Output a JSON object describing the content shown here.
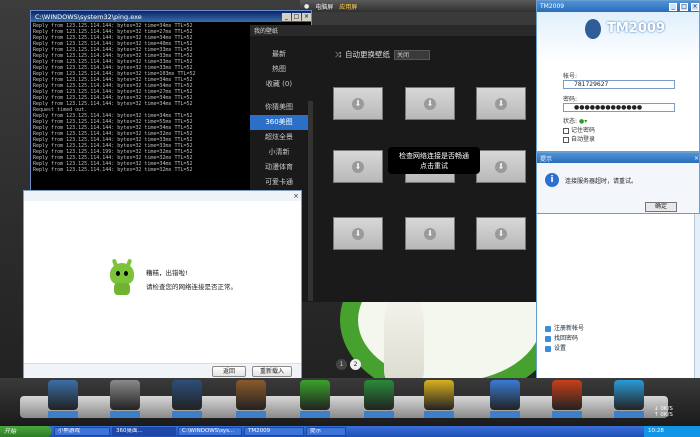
{
  "topbar": {
    "items": [
      "电脑屏",
      "应用屏"
    ],
    "active_index": 1
  },
  "cmd": {
    "title": "C:\\WINDOWS\\system32\\ping.exe",
    "lines": [
      "Reply from 123.125.114.144: bytes=32 time=34ms TTL=52",
      "Reply from 123.125.114.144: bytes=32 time=27ms TTL=52",
      "Reply from 123.125.114.144: bytes=32 time=34ms TTL=52",
      "Reply from 123.125.114.144: bytes=32 time=40ms TTL=52",
      "Reply from 123.125.114.144: bytes=32 time=33ms TTL=52",
      "Reply from 123.125.114.144: bytes=32 time=33ms TTL=52",
      "Reply from 123.125.114.144: bytes=32 time=33ms TTL=52",
      "Reply from 123.125.114.144: bytes=32 time=33ms TTL=52",
      "Reply from 123.125.114.144: bytes=32 time=103ms TTL=52",
      "Reply from 123.125.114.144: bytes=32 time=34ms TTL=52",
      "Reply from 123.125.114.144: bytes=32 time=34ms TTL=52",
      "Reply from 123.125.114.144: bytes=32 time=27ms TTL=52",
      "Reply from 123.125.114.144: bytes=32 time=34ms TTL=52",
      "Reply from 123.125.114.144: bytes=32 time=34ms TTL=52",
      "Request timed out.",
      "Reply from 123.125.114.144: bytes=32 time=34ms TTL=52",
      "Reply from 123.125.114.144: bytes=32 time=55ms TTL=52",
      "Reply from 123.125.114.144: bytes=32 time=34ms TTL=52",
      "Reply from 123.125.114.144: bytes=32 time=32ms TTL=52",
      "Reply from 123.125.114.144: bytes=32 time=33ms TTL=52",
      "Reply from 123.125.114.144: bytes=32 time=33ms TTL=52",
      "Reply from 123.125.114.199: bytes=32 time=32ms TTL=52",
      "Reply from 123.125.114.144: bytes=32 time=32ms TTL=52",
      "Reply from 123.125.114.144: bytes=32 time=34ms TTL=52",
      "Reply from 123.125.114.144: bytes=32 time=32ms TTL=52"
    ]
  },
  "wallpaper": {
    "title": "我的壁纸",
    "nav": [
      "最新",
      "热图",
      "收藏 (0)",
      "",
      "你猜美图",
      "360美图",
      "超炫全景",
      "小清新",
      "动漫体育",
      "可爱卡通"
    ],
    "selected_nav_index": 5,
    "auto_change_label": "自动更换壁纸",
    "auto_change_value": "关闭",
    "network_msg_line1": "检查网络连接是否畅通",
    "network_msg_line2": "点击重试"
  },
  "qq": {
    "title": "TM2009",
    "logo": "TM2009",
    "account_label": "帐号:",
    "account_value": "781729627",
    "password_label": "密码:",
    "password_value": "●●●●●●●●●●●●●",
    "status_label": "状态:",
    "remember_label": "记住密码",
    "autologin_label": "自动登录",
    "links": [
      "注册新帐号",
      "找回密码",
      "设置"
    ],
    "title_btns": [
      "_",
      "□",
      "×"
    ]
  },
  "tip": {
    "title": "提示",
    "message": "连接服务器超时，请重试。",
    "ok_label": "确定",
    "close": "×"
  },
  "error": {
    "close": "×",
    "msg1": "糟糕，出错啦!",
    "msg2": "请检查您的网络连接是否正常。",
    "back_label": "返回",
    "reload_label": "重新载入"
  },
  "pager": [
    "1",
    "2"
  ],
  "dock": {
    "items": [
      {
        "label": "",
        "color": "#3b6ea8"
      },
      {
        "label": "",
        "color": "#8a8a8a"
      },
      {
        "label": "",
        "color": "#2c4f7a"
      },
      {
        "label": "",
        "color": "#8b5a2b"
      },
      {
        "label": "",
        "color": "#3aa32a"
      },
      {
        "label": "",
        "color": "#2a8a3a"
      },
      {
        "label": "",
        "color": "#d8b020"
      },
      {
        "label": "",
        "color": "#3a7bd5"
      },
      {
        "label": "",
        "color": "#c8401a"
      },
      {
        "label": "",
        "color": "#2b9ad8"
      }
    ],
    "speed_down": "0K/S",
    "speed_up": "0K/S"
  },
  "taskbar": {
    "start": "开始",
    "tasks": [
      "小熊游戏",
      "360桌面...",
      "C:\\WINDOWS\\sys...",
      "TM2009",
      "提示"
    ],
    "active_index": 1,
    "tray": "10:28"
  }
}
